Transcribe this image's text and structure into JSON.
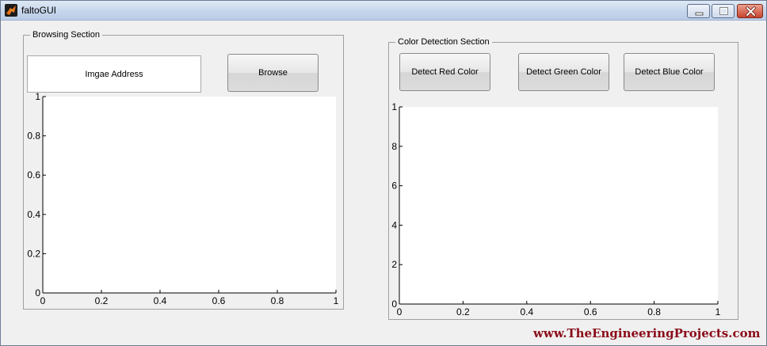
{
  "window": {
    "title": "faltoGUI"
  },
  "browsing_section": {
    "title": "Browsing Section",
    "address_text": "Imgae Address",
    "browse_label": "Browse"
  },
  "color_section": {
    "title": "Color Detection Section",
    "red_label": "Detect Red Color",
    "green_label": "Detect Green Color",
    "blue_label": "Detect Blue Color"
  },
  "watermark": "www.TheEngineeringProjects.com",
  "chart_data": [
    {
      "type": "scatter",
      "title": "",
      "xlabel": "",
      "ylabel": "",
      "xlim": [
        0,
        1
      ],
      "ylim": [
        0,
        1
      ],
      "x_ticks": [
        "0",
        "0.2",
        "0.4",
        "0.6",
        "0.8",
        "1"
      ],
      "y_ticks": [
        "0",
        "0.2",
        "0.4",
        "0.6",
        "0.8",
        "1"
      ],
      "series": [],
      "grid": false
    },
    {
      "type": "scatter",
      "title": "",
      "xlabel": "",
      "ylabel": "",
      "xlim": [
        0,
        1
      ],
      "ylim": [
        0,
        10
      ],
      "x_ticks": [
        "0",
        "0.2",
        "0.4",
        "0.6",
        "0.8",
        "1"
      ],
      "y_ticks": [
        "0",
        "2",
        "4",
        "6",
        "8",
        "1"
      ],
      "series": [],
      "grid": false
    }
  ]
}
